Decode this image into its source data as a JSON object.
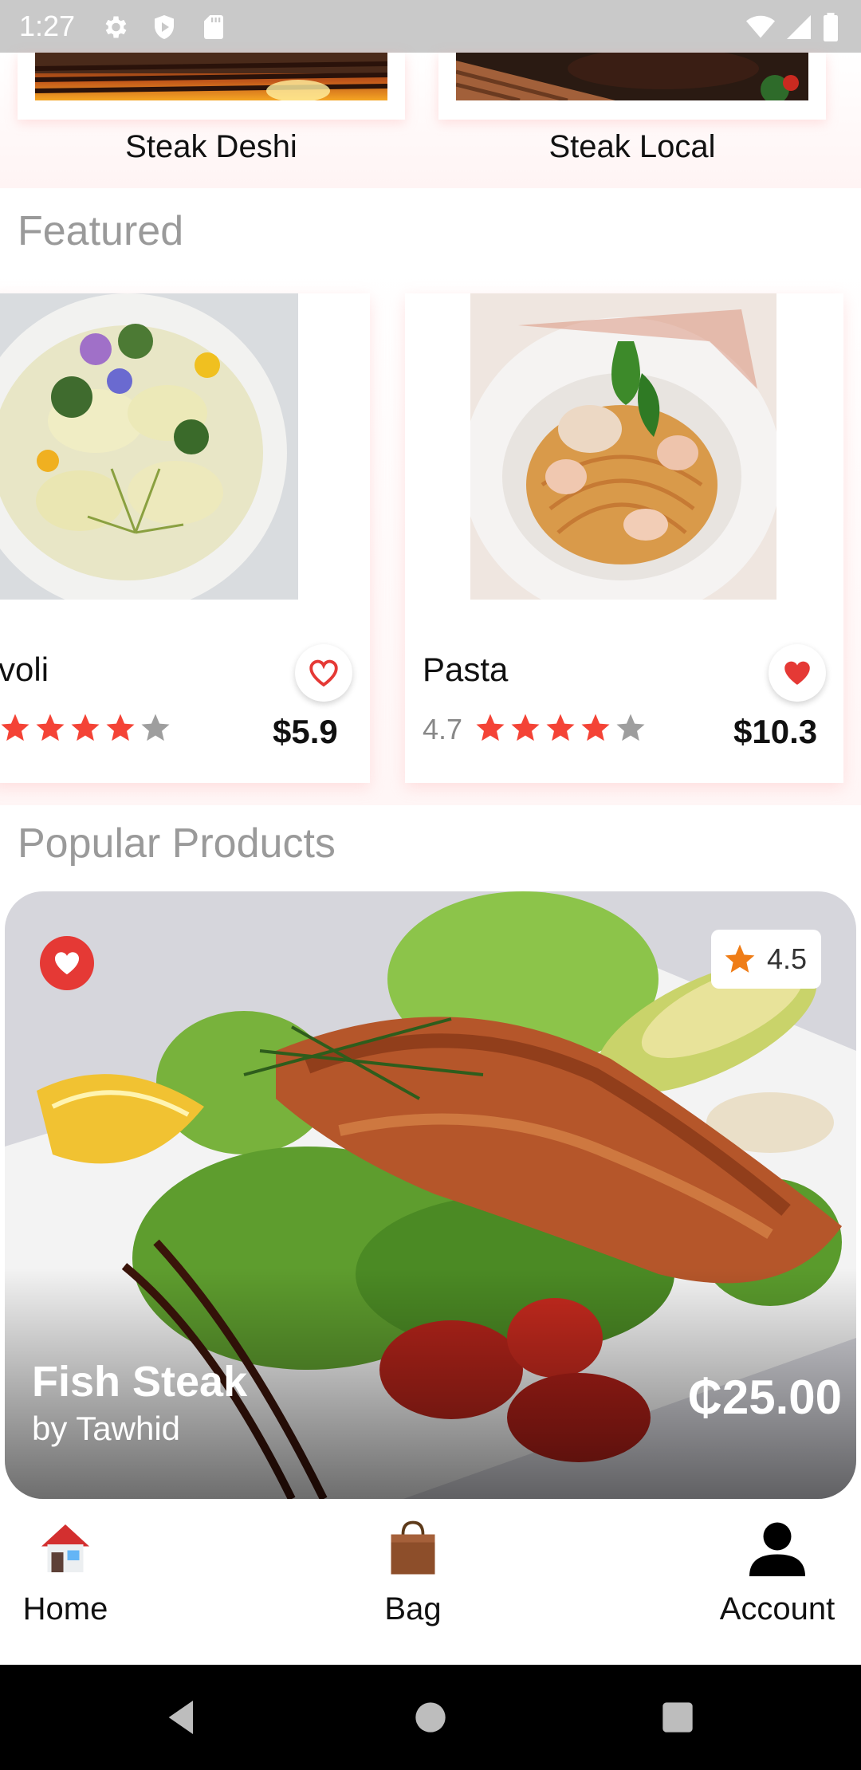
{
  "status_bar": {
    "time": "1:27",
    "icons": [
      "gear-icon",
      "shield-icon",
      "sd-card-icon",
      "wifi-icon",
      "signal-icon",
      "battery-icon"
    ]
  },
  "categories": [
    {
      "label": "Steak Deshi",
      "image": "grilled-steak-photo"
    },
    {
      "label": "Steak Local",
      "image": "steak-on-board-photo"
    }
  ],
  "featured": {
    "title": "Featured",
    "items": [
      {
        "name": "voli",
        "rating_text": "",
        "rating": 4,
        "price": "$5.9",
        "favorited": false,
        "image": "ravioli-photo"
      },
      {
        "name": "Pasta",
        "rating_text": "4.7",
        "rating": 4,
        "price": "$10.3",
        "favorited": true,
        "image": "pasta-photo"
      }
    ]
  },
  "popular": {
    "title": "Popular Products",
    "item": {
      "name": "Fish Steak",
      "by": "by Tawhid",
      "price": "₵25.00",
      "rating": "4.5",
      "favorited": true,
      "image": "fish-steak-photo"
    }
  },
  "bottom_nav": [
    {
      "label": "Home",
      "icon": "home-icon"
    },
    {
      "label": "Bag",
      "icon": "bag-icon"
    },
    {
      "label": "Account",
      "icon": "account-icon"
    }
  ],
  "system_nav": [
    "back-icon",
    "home-circle-icon",
    "recents-icon"
  ],
  "colors": {
    "accent_red": "#e53935",
    "star_red": "#f44336",
    "star_gray": "#9e9e9e",
    "star_orange": "#ef7d17",
    "section_title": "#9a9a9a"
  }
}
